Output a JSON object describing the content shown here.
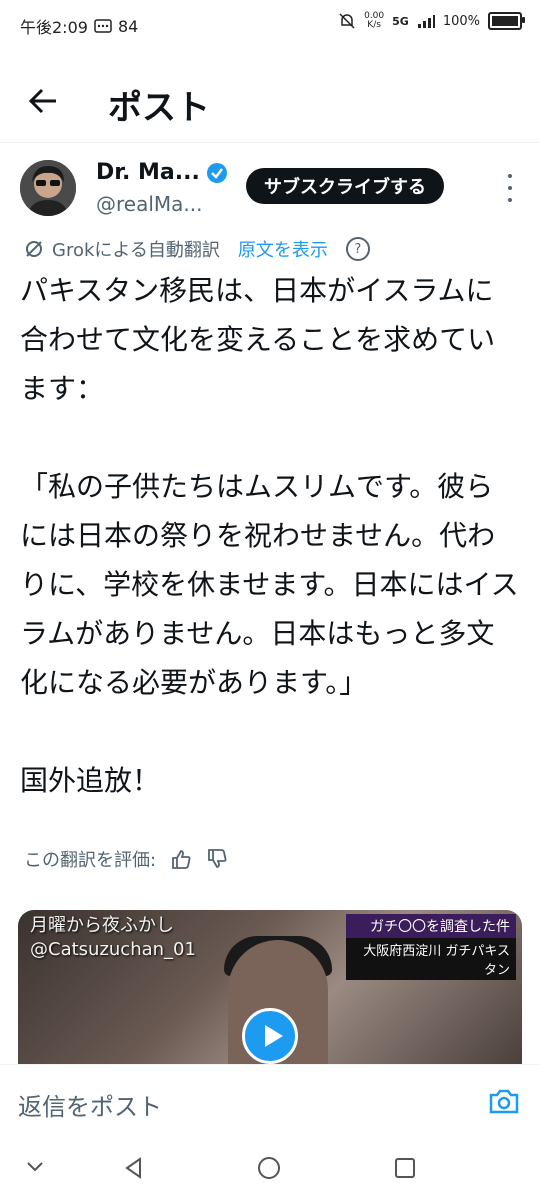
{
  "status_bar": {
    "time": "午後2:09",
    "notification_count": "84",
    "net_speed_value": "0.00",
    "net_speed_unit": "K/s",
    "network": "5G",
    "battery": "100%"
  },
  "header": {
    "title": "ポスト"
  },
  "post": {
    "author_name": "Dr. Ma...",
    "author_handle": "@realMa...",
    "subscribe_label": "サブスクライブする",
    "translation_note": "Grokによる自動翻訳",
    "show_original_label": "原文を表示",
    "help_label": "?",
    "body": "パキスタン移民は、日本がイスラムに合わせて文化を変えることを求めています：\n\n「私の子供たちはムスリムです。彼らには日本の祭りを祝わせません。代わりに、学校を休ませます。日本にはイスラムがありません。日本はもっと多文化になる必要があります。」\n\n国外追放！",
    "rate_translation_label": "この翻訳を評価:"
  },
  "media": {
    "overlay_left_line1": "月曜から夜ふかし",
    "overlay_left_line2": "@Catsuzuchan_01",
    "overlay_right_line1": "ガチ〇〇を調査した件",
    "overlay_right_line2": "大阪府西淀川 ガチパキスタン",
    "battery_level": 1.0
  },
  "reply_bar": {
    "placeholder": "返信をポスト"
  },
  "icons": {
    "back": "back-arrow-icon",
    "verified": "verified-badge-icon",
    "more": "more-vertical-icon",
    "grok": "grok-icon",
    "help": "help-icon",
    "thumbs_up": "thumbs-up-icon",
    "thumbs_down": "thumbs-down-icon",
    "play": "play-icon",
    "camera": "camera-icon"
  },
  "colors": {
    "accent": "#1d9bf0",
    "text": "#0f1419",
    "secondary": "#536471"
  }
}
